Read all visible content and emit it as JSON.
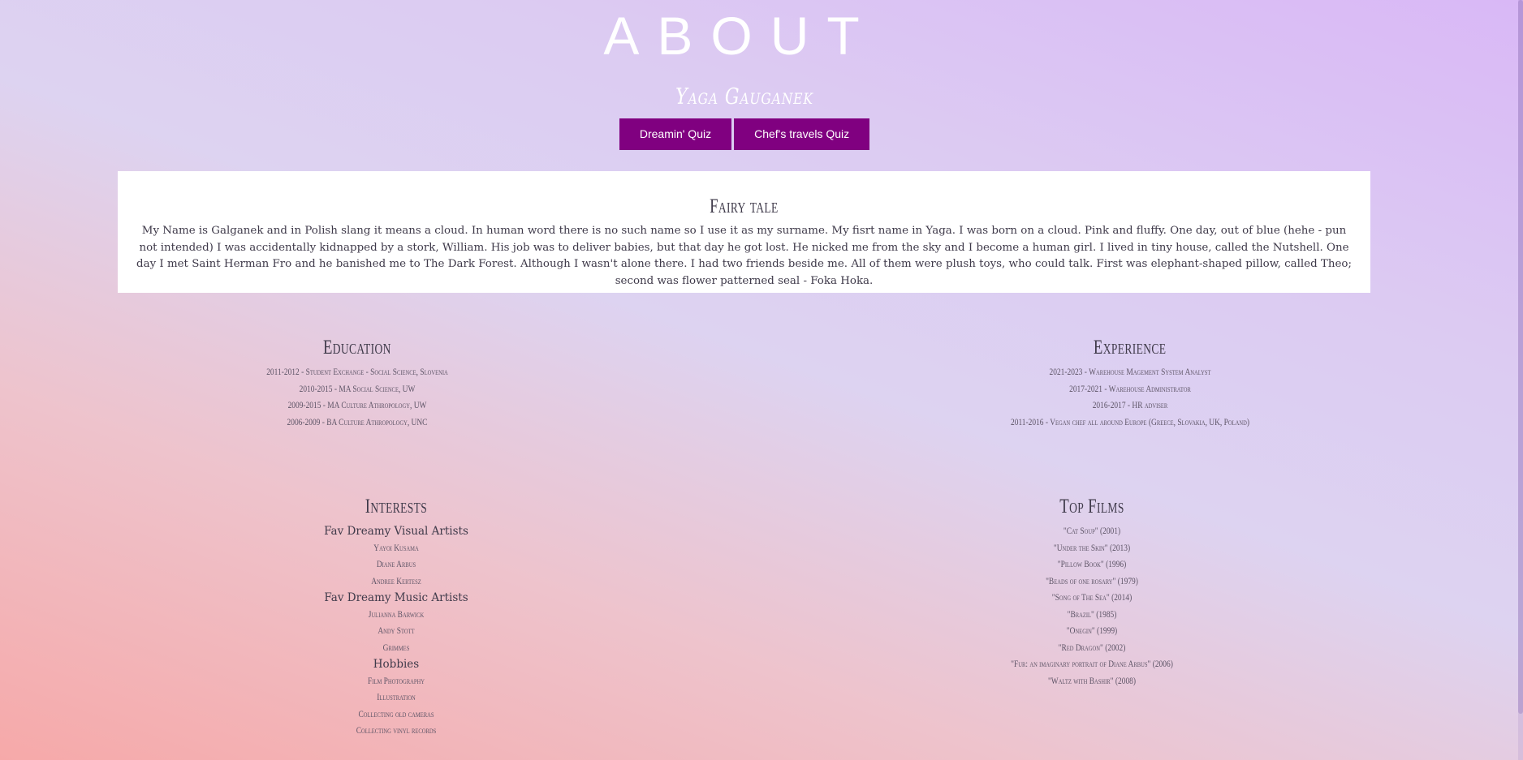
{
  "header": {
    "title": "ABOUT",
    "subtitle": "Yaga Gauganek"
  },
  "quiz_buttons": [
    {
      "label": "Dreamin' Quiz"
    },
    {
      "label": "Chef's travels Quiz"
    }
  ],
  "fairy_tale": {
    "heading": "Fairy tale",
    "text": "My Name is Galganek and in Polish slang it means a cloud. In human word there is no such name so I use it as my surname. My fisrt name in Yaga. I was born on a cloud. Pink and fluffy. One day, out of blue (hehe - pun not intended) I was accidentally kidnapped by a stork, William. His job was to deliver babies, but that day he got lost. He nicked me from the sky and I become a human girl. I lived in tiny house, called the Nutshell. One day I met Saint Herman Fro and he banished me to The Dark Forest. Although I wasn't alone there. I had two friends beside me. All of them were plush toys, who could talk. First was elephant-shaped pillow, called Theo; second was flower patterned seal - Foka Hoka."
  },
  "education": {
    "heading": "Education",
    "items": [
      "2011-2012 - Student Exchange - Social Science, Slovenia",
      "2010-2015 - MA Social Science, UW",
      "2009-2015 - MA Culture Athropology, UW",
      "2006-2009 - BA Culture Athropology, UNC"
    ]
  },
  "experience": {
    "heading": "Experience",
    "items": [
      "2021-2023 - Warehouse Magement System Analyst",
      "2017-2021 - Warehouse Administrator",
      "2016-2017 - HR adviser",
      "2011-2016 - Vegan chef all around Europe (Greece, Slovakia, UK, Poland)"
    ]
  },
  "interests": {
    "heading": "Interests",
    "groups": [
      {
        "title": "Fav Dreamy Visual Artists",
        "items": [
          "Yayoi Kusama",
          "Diane Arbus",
          "Andree Kertesz"
        ]
      },
      {
        "title": "Fav Dreamy Music Artists",
        "items": [
          "Julianna Barwick",
          "Andy Stott",
          "Grimmes"
        ]
      },
      {
        "title": "Hobbies",
        "items": [
          "Film Photography",
          "Illustration",
          "Collecting old cameras",
          "Collecting vinyl records"
        ]
      }
    ]
  },
  "films": {
    "heading": "Top Films",
    "items": [
      "\"Cat Soup\" (2001)",
      "\"Under the Skin\" (2013)",
      "\"Pillow Book\" (1996)",
      "\"Beads of one rosary\" (1979)",
      "\"Song of The Sea\" (2014)",
      "\"Brazil\" (1985)",
      "\"Onegin\" (1999)",
      "\"Red Dragon\" (2002)",
      "\"Fur: an imaginary portrait of Diane Arbus\" (2006)",
      "\"Waltz with Bashir\" (2008)"
    ]
  },
  "colors": {
    "button_bg": "#800080",
    "card_bg": "#ffffff",
    "title_color": "#ffffff"
  }
}
